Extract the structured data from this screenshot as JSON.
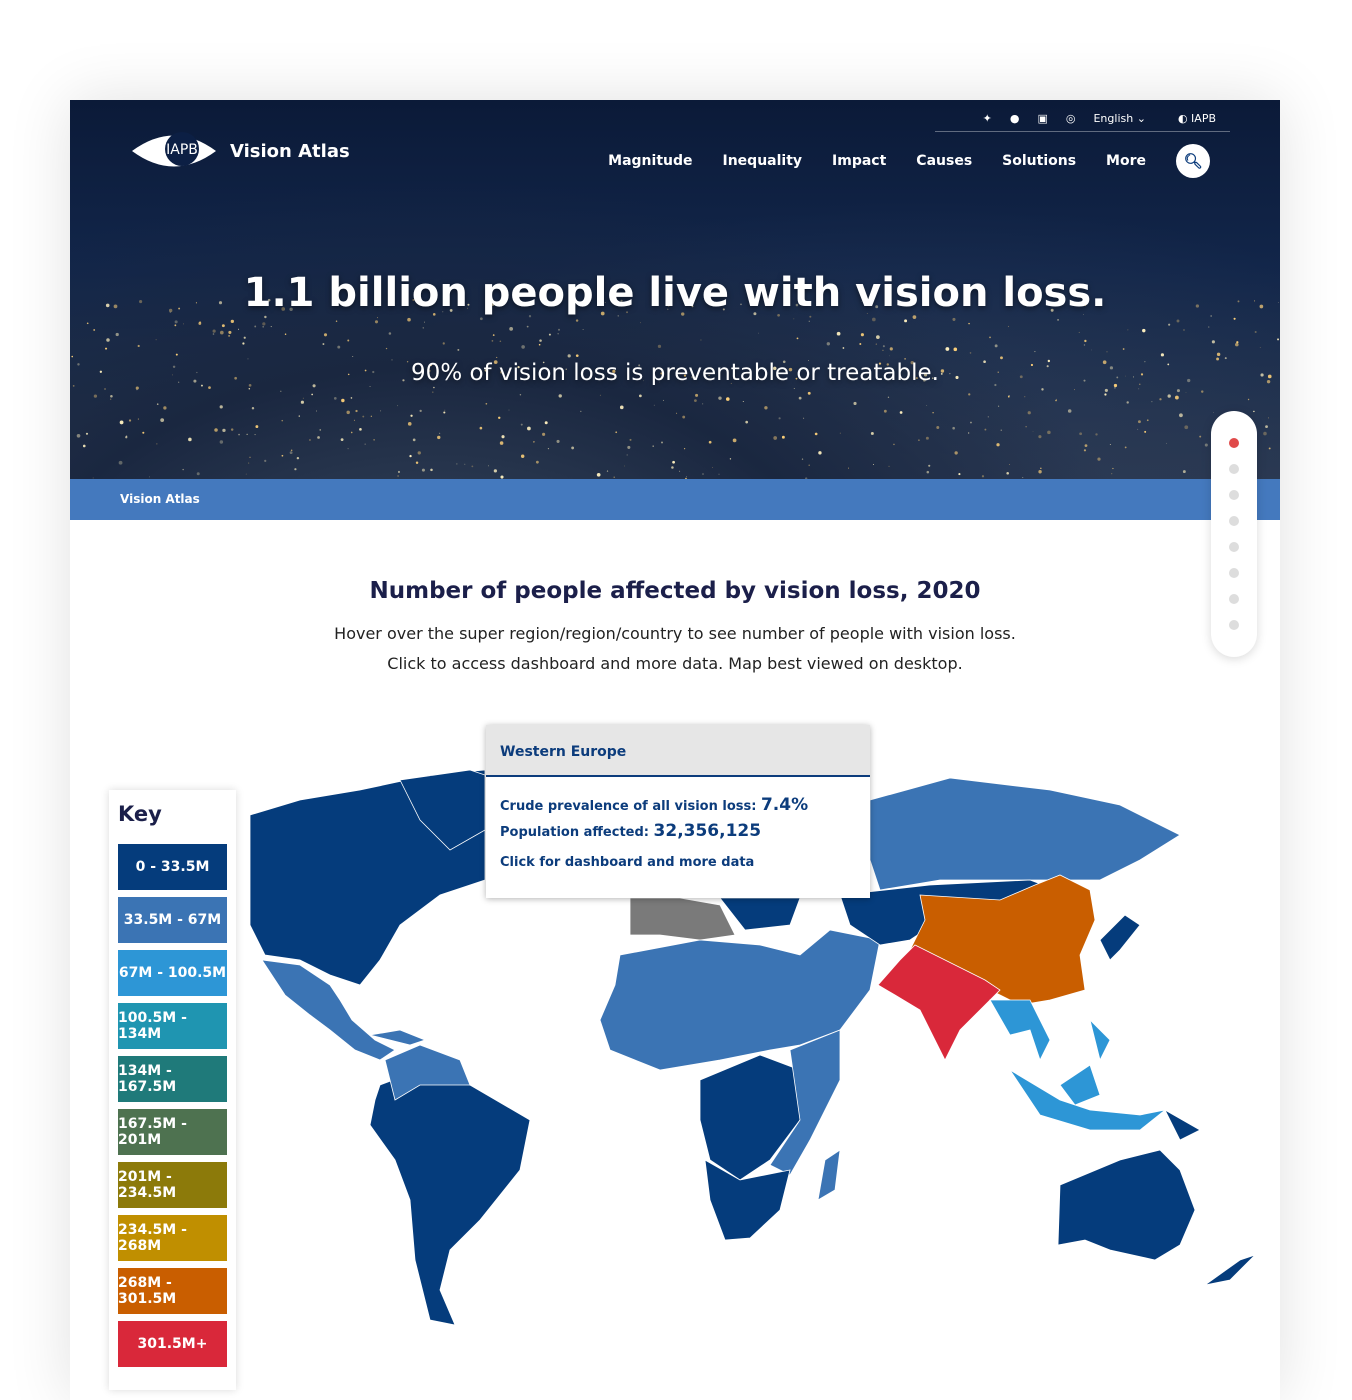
{
  "header": {
    "logo_mark": "IAPB",
    "site_name": "Vision Atlas",
    "social": [
      {
        "icon": "twitter-icon",
        "glyph": "🐦"
      },
      {
        "icon": "facebook-icon",
        "glyph": "f"
      },
      {
        "icon": "linkedin-icon",
        "glyph": "in"
      },
      {
        "icon": "instagram-icon",
        "glyph": "◎"
      }
    ],
    "language": "English",
    "org_link": "IAPB",
    "nav": [
      "Magnitude",
      "Inequality",
      "Impact",
      "Causes",
      "Solutions",
      "More"
    ]
  },
  "hero": {
    "headline": "1.1 billion people live with vision loss.",
    "subhead": "90% of vision loss is preventable or treatable."
  },
  "breadcrumb": "Vision Atlas",
  "section": {
    "title": "Number of people affected by vision loss, 2020",
    "line1": "Hover over the super region/region/country to see number of people with vision loss.",
    "line2": "Click to access dashboard and more data. Map best viewed on desktop."
  },
  "key": {
    "title": "Key",
    "items": [
      {
        "label": "0 - 33.5M",
        "color": "#053c7c"
      },
      {
        "label": "33.5M - 67M",
        "color": "#3b74b4"
      },
      {
        "label": "67M - 100.5M",
        "color": "#2d96d6"
      },
      {
        "label": "100.5M - 134M",
        "color": "#1f95b1"
      },
      {
        "label": "134M - 167.5M",
        "color": "#1f7a7a"
      },
      {
        "label": "167.5M - 201M",
        "color": "#4e7250"
      },
      {
        "label": "201M - 234.5M",
        "color": "#8c7a0a"
      },
      {
        "label": "234.5M - 268M",
        "color": "#c08f00"
      },
      {
        "label": "268M - 301.5M",
        "color": "#c95e00"
      },
      {
        "label": "301.5M+",
        "color": "#d9283a"
      }
    ]
  },
  "tooltip": {
    "region": "Western Europe",
    "prevalence_label": "Crude prevalence of all vision loss:",
    "prevalence": "7.4%",
    "population_label": "Population affected:",
    "population": "32,356,125",
    "link": "Click for dashboard and more data"
  },
  "scroll_nav": {
    "sections": 8,
    "active": 1
  }
}
